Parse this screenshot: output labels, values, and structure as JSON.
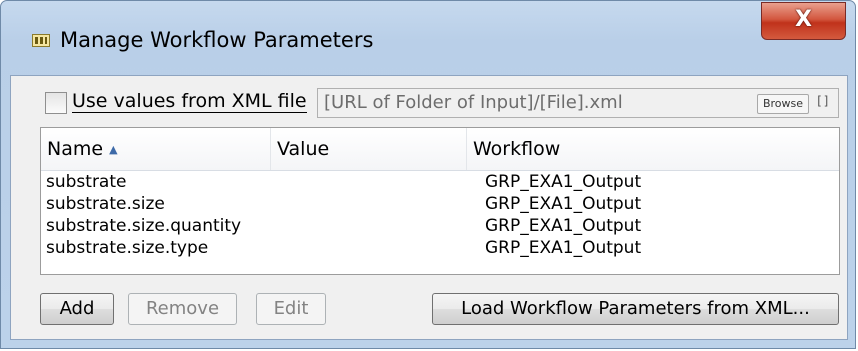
{
  "window": {
    "title": "Manage Workflow Parameters",
    "close_label": "X"
  },
  "xml_source": {
    "checkbox_label": "Use values from XML file",
    "checked": false,
    "url_value": "[URL of Folder of Input]/[File].xml",
    "browse_label": "Browse",
    "extra_label": "[]"
  },
  "table": {
    "columns": [
      "Name",
      "Value",
      "Workflow"
    ],
    "sort_column": "Name",
    "sort_direction": "ascending",
    "rows": [
      {
        "name": "substrate",
        "value": "",
        "workflow": "GRP_EXA1_Output"
      },
      {
        "name": "substrate.size",
        "value": "",
        "workflow": "GRP_EXA1_Output"
      },
      {
        "name": "substrate.size.quantity",
        "value": "",
        "workflow": "GRP_EXA1_Output"
      },
      {
        "name": "substrate.size.type",
        "value": "",
        "workflow": "GRP_EXA1_Output"
      }
    ]
  },
  "buttons": {
    "add": "Add",
    "remove": "Remove",
    "edit": "Edit",
    "load_xml": "Load Workflow Parameters from XML..."
  },
  "colors": {
    "close_button": "#c7412a",
    "frame": "#bcd2ea",
    "sort_arrow": "#3d6aa8"
  }
}
